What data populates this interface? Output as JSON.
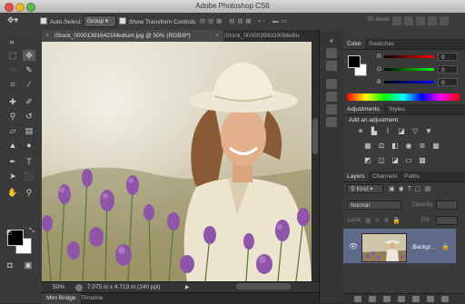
{
  "app": {
    "title": "Adobe Photoshop CS6"
  },
  "options_bar": {
    "auto_select_label": "Auto-Select:",
    "auto_select_value": "Group",
    "show_transform_label": "Show Transform Controls",
    "mode_3d_label": "3D Mode:"
  },
  "document_tabs": [
    {
      "label": "iStock_000013916421Medium.jpg @ 50% (RGB/8*)",
      "active": true
    },
    {
      "label": "iStock_000003993390Mediu",
      "active": false
    }
  ],
  "status_bar": {
    "zoom": "50%",
    "doc_info": "7.075 in x 4.713 in (240 ppi)"
  },
  "bottom_tabs": [
    {
      "label": "Mini Bridge",
      "active": true
    },
    {
      "label": "Timeline",
      "active": false
    }
  ],
  "color_panel": {
    "tabs": [
      {
        "label": "Color",
        "active": true
      },
      {
        "label": "Swatches",
        "active": false
      }
    ],
    "channels": [
      {
        "label": "R",
        "value": "0",
        "color": "#d03030"
      },
      {
        "label": "G",
        "value": "0",
        "color": "#30b040"
      },
      {
        "label": "B",
        "value": "0",
        "color": "#3050d0"
      }
    ],
    "foreground": "#000000",
    "background": "#ffffff"
  },
  "adjustments_panel": {
    "tabs": [
      {
        "label": "Adjustments",
        "active": true
      },
      {
        "label": "Styles",
        "active": false
      }
    ],
    "heading": "Add an adjustment"
  },
  "layers_panel": {
    "tabs": [
      {
        "label": "Layers",
        "active": true
      },
      {
        "label": "Channels",
        "active": false
      },
      {
        "label": "Paths",
        "active": false
      }
    ],
    "filter_kind": "Kind",
    "blend_mode": "Normal",
    "opacity_label": "Opacity:",
    "lock_label": "Lock:",
    "fill_label": "Fill:",
    "layer_name": "Backgr..."
  },
  "colors": {
    "accent_layer": "#5d6a8a",
    "panel_bg": "#3a3a3a"
  }
}
